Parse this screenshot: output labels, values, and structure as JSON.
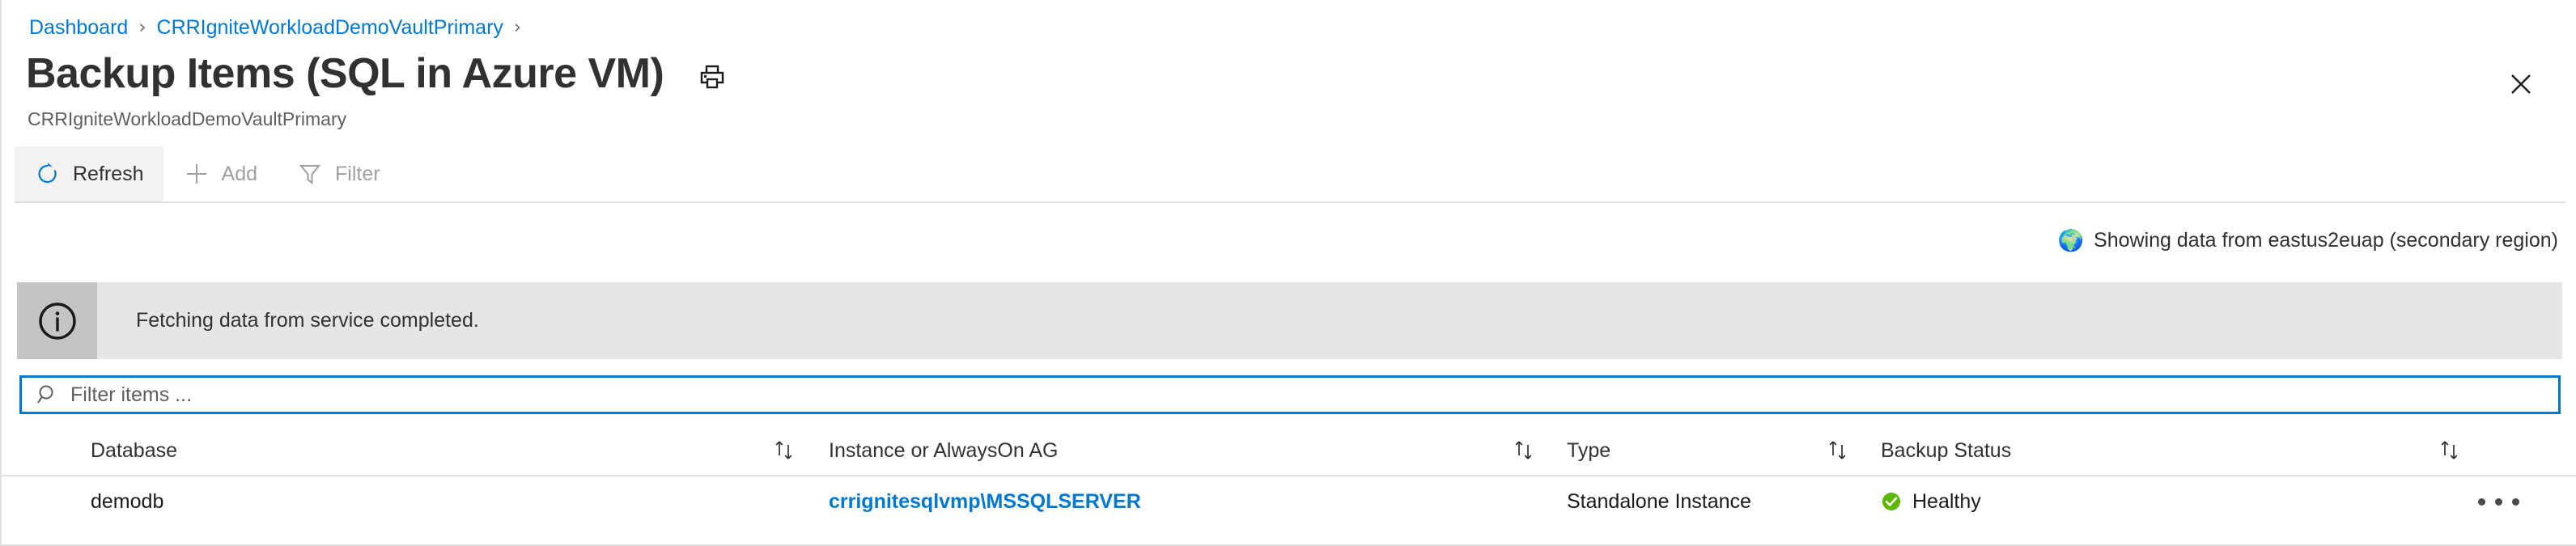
{
  "breadcrumb": {
    "items": [
      {
        "label": "Dashboard"
      },
      {
        "label": "CRRIgniteWorkloadDemoVaultPrimary"
      }
    ],
    "separator": "›"
  },
  "header": {
    "title": "Backup Items (SQL in Azure VM)",
    "subtitle": "CRRIgniteWorkloadDemoVaultPrimary",
    "print_icon": "printer-icon",
    "close_icon": "close-icon"
  },
  "toolbar": {
    "items": [
      {
        "label": "Refresh",
        "icon": "refresh-icon",
        "enabled": true
      },
      {
        "label": "Add",
        "icon": "plus-icon",
        "enabled": false
      },
      {
        "label": "Filter",
        "icon": "funnel-icon",
        "enabled": false
      }
    ]
  },
  "region_note": {
    "icon": "globe-icon",
    "glyph": "🌍",
    "text": "Showing data from eastus2euap (secondary region)"
  },
  "banner": {
    "icon": "info-icon",
    "glyph": "i",
    "message": "Fetching data from service completed."
  },
  "search": {
    "placeholder": "Filter items ...",
    "value": "",
    "icon": "search-icon"
  },
  "table": {
    "columns": [
      {
        "label": "Database",
        "sortable": true
      },
      {
        "label": "Instance or AlwaysOn AG",
        "sortable": true
      },
      {
        "label": "Type",
        "sortable": true
      },
      {
        "label": "Backup Status",
        "sortable": true
      }
    ],
    "rows": [
      {
        "database": "demodb",
        "instance": "crrignitesqlvmp\\MSSQLSERVER",
        "type": "Standalone Instance",
        "status": "Healthy",
        "status_icon": "check-circle-icon",
        "menu_icon": "ellipsis-icon"
      }
    ]
  },
  "colors": {
    "link": "#0078d4",
    "accent": "#0078d4",
    "healthy": "#5bb700",
    "banner_bg": "#e6e6e6",
    "banner_icon_bg": "#c4c4c4"
  }
}
